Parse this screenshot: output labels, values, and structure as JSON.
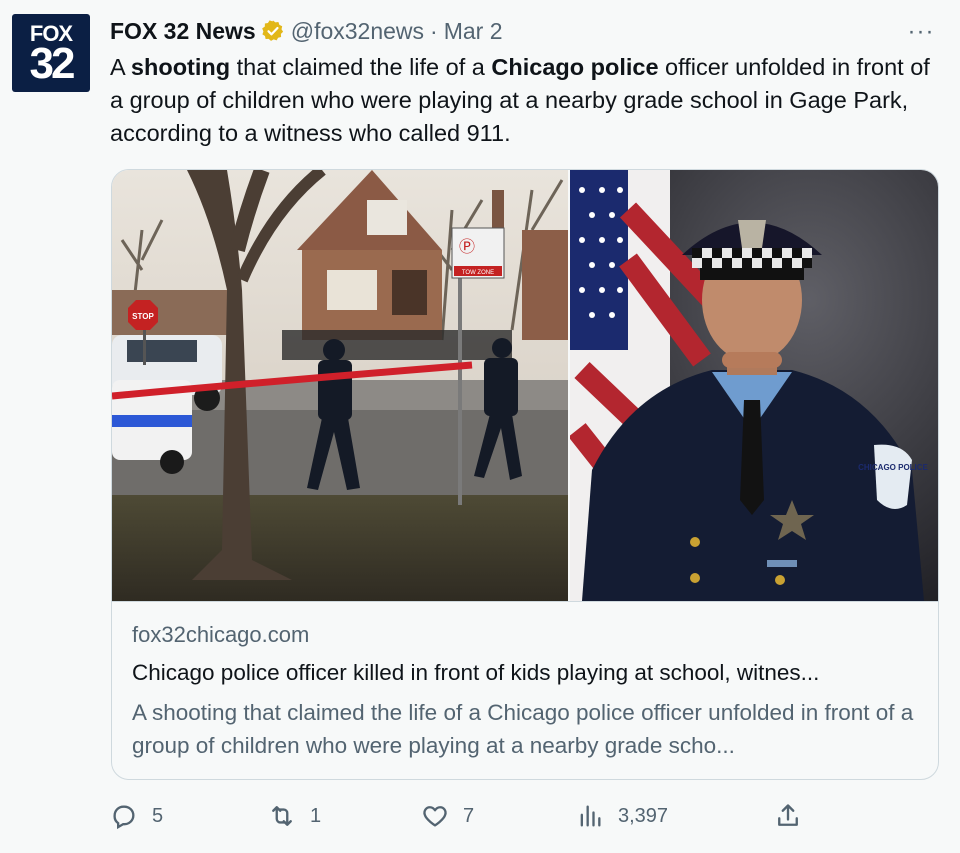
{
  "account": {
    "avatar_line1": "FOX",
    "avatar_line2": "32",
    "name": "FOX 32 News",
    "handle": "@fox32news",
    "separator": "·",
    "date": "Mar 2",
    "verified_badge": "gold-verified-icon"
  },
  "more_label": "···",
  "tweet": {
    "t1": "A ",
    "b1": "shooting",
    "t2": " that claimed the life of a ",
    "b2": "Chicago police",
    "t3": " officer unfolded in front of a group of children who were playing at a nearby grade school in Gage Park, according to a witness who called 911."
  },
  "media": {
    "left_photo": {
      "stop_sign": "STOP",
      "parking_sign": "Ⓟ",
      "tow_zone": "TOW ZONE"
    },
    "right_photo": {
      "patch": "CHICAGO POLICE"
    }
  },
  "card": {
    "domain": "fox32chicago.com",
    "title": "Chicago police officer killed in front of kids playing at school, witnes...",
    "description": "A shooting that claimed the life of a Chicago police officer unfolded in front of a group of children who were playing at a nearby grade scho..."
  },
  "actions": {
    "replies": "5",
    "reposts": "1",
    "likes": "7",
    "views": "3,397"
  },
  "colors": {
    "brand_navy": "#0b1f44",
    "text_primary": "#0f1419",
    "text_secondary": "#536471",
    "verified_gold": "#e2b719",
    "border": "#cfd9de"
  }
}
